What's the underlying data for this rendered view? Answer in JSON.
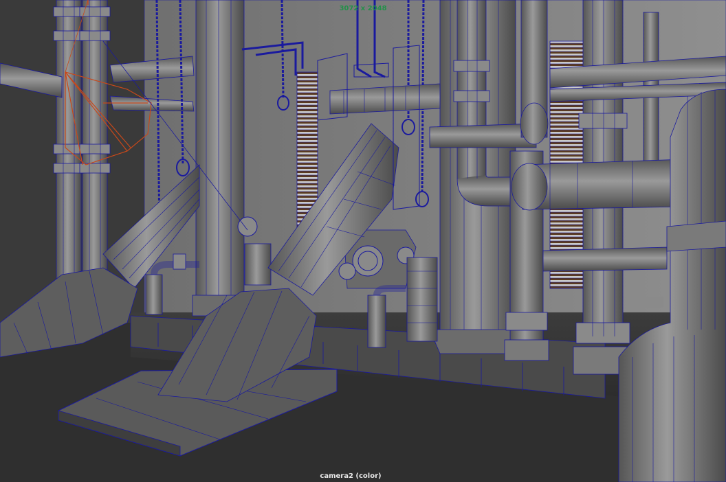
{
  "viewport": {
    "resolution_gate": "3072 x 2048",
    "camera_label": "camera2 (color)"
  },
  "colors": {
    "wire": "#1a1a9e",
    "wall": "#8a8a8a",
    "floor": "#3a3a3a",
    "camera_gizmo": "#c8481a",
    "resolution_text": "#23904a"
  },
  "icons": [
    "camera-gizmo-icon"
  ]
}
